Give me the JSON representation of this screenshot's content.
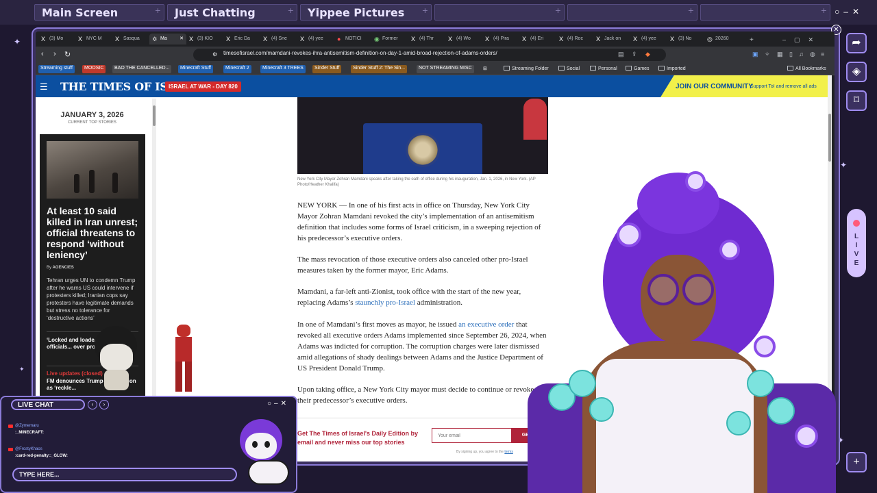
{
  "scenes": [
    {
      "label": "Main Screen"
    },
    {
      "label": "Just Chatting"
    },
    {
      "label": "Yippee Pictures"
    },
    {
      "label": ""
    },
    {
      "label": ""
    },
    {
      "label": ""
    }
  ],
  "browser": {
    "tabs": [
      {
        "icon": "X",
        "label": "(3) Mo"
      },
      {
        "icon": "X",
        "label": "NYC M"
      },
      {
        "icon": "X",
        "label": "Sasqua"
      },
      {
        "icon": "✡",
        "label": "Ma"
      },
      {
        "icon": "X",
        "label": "(3) KIO"
      },
      {
        "icon": "X",
        "label": "Eric Da"
      },
      {
        "icon": "X",
        "label": "(4) Sne"
      },
      {
        "icon": "X",
        "label": "(4) yee"
      },
      {
        "icon": "●",
        "label": "NOTICI"
      },
      {
        "icon": "◉",
        "label": "Former"
      },
      {
        "icon": "X",
        "label": "(4) Thr"
      },
      {
        "icon": "X",
        "label": "(4) Wo"
      },
      {
        "icon": "X",
        "label": "(4) Pira"
      },
      {
        "icon": "X",
        "label": "(4) Eri"
      },
      {
        "icon": "X",
        "label": "(4) Roc"
      },
      {
        "icon": "X",
        "label": "Jack on"
      },
      {
        "icon": "X",
        "label": "(4) yee"
      },
      {
        "icon": "X",
        "label": "(3) No"
      },
      {
        "icon": "◎",
        "label": "20260"
      }
    ],
    "url": "timesofisrael.com/mamdani-revokes-ihra-antisemitism-definition-on-day-1-amid-broad-rejection-of-adams-orders/",
    "bookmarks": [
      {
        "label": "Streaming stuff",
        "bg": "#1f5fae",
        "fg": "#ffffff"
      },
      {
        "label": "MOOSIC",
        "bg": "#c0392b",
        "fg": "#ffffff"
      },
      {
        "label": "BAO THE CANCELLED...",
        "bg": "#4a4b4f",
        "fg": "#ffffff"
      },
      {
        "label": "Minecraft Stuff",
        "bg": "#1f5fae",
        "fg": "#ffffff"
      },
      {
        "label": "Minecraft 2",
        "bg": "#1f5fae",
        "fg": "#ffffff"
      },
      {
        "label": "Minecraft 3 TREES",
        "bg": "#1f5fae",
        "fg": "#ffffff"
      },
      {
        "label": "Sinder Stuff",
        "bg": "#8a5a1e",
        "fg": "#ffffff"
      },
      {
        "label": "Sinder Stuff 2: The Sin...",
        "bg": "#8a5a1e",
        "fg": "#ffffff"
      },
      {
        "label": "NOT STREAMING MISC",
        "bg": "#4a4b4f",
        "fg": "#ffffff"
      }
    ],
    "folders": [
      "Streaming Folder",
      "Social",
      "Personal",
      "Games",
      "Imported"
    ],
    "all_bookmarks": "All Bookmarks"
  },
  "site": {
    "logo": "THE TIMES OF ISRAEL",
    "badge": "ISRAEL AT WAR - DAY 820",
    "join": "JOIN OUR COMMUNITY",
    "join_sub": "Support ToI and remove all ads"
  },
  "sidebar": {
    "date": "JANUARY 3, 2026",
    "date_sub": "CURRENT TOP STORIES",
    "headline": "At least 10 said killed in Iran unrest; official threatens to respond ‘without leniency’",
    "byline_prefix": "By",
    "byline": "AGENCIES",
    "sub_story": "Tehran urges UN to condemn Trump after he warns US could intervene if protesters killed; Iranian cops say protesters have legitimate demands but stress no tolerance for ‘destructive actions’",
    "sub2": "‘Locked and loade... Iranian officials... over protests",
    "live_label": "Live updates (closed)",
    "sub3": "FM denounces Trump intervention as ‘reckle..."
  },
  "article": {
    "caption": "New York City Mayor Zohran Mamdani speaks after taking the oath of office during his inauguration, Jan. 1, 2026, in New York. (AP Photo/Heather Khalifa)",
    "p1": "NEW YORK — In one of his first acts in office on Thursday, New York City Mayor Zohran Mamdani revoked the city’s implementation of an antisemitism definition that includes some forms of Israel criticism, in a sweeping rejection of his predecessor’s executive orders.",
    "p2": "The mass revocation of those executive orders also canceled other pro-Israel measures taken by the former mayor, Eric Adams.",
    "p3a": "Mamdani, a far-left anti-Zionist, took office with the start of the new year, replacing Adams’s ",
    "p3link": "staunchly pro-Israel",
    "p3b": " administration.",
    "p4a": "In one of Mamdani’s first moves as mayor, he issued ",
    "p4link": "an executive order",
    "p4b": " that revoked all executive orders Adams implemented since September 26, 2024, when Adams was indicted for corruption. The corruption charges were later dismissed amid allegations of shady dealings between Adams and the Justice Department of US President Donald Trump.",
    "p5": "Upon taking office, a New York City mayor must decide to continue or revoke their predecessor’s executive orders.",
    "signup_title": "Get The Times of Israel's Daily Edition by email and never miss our top stories",
    "email_placeholder": "Your email",
    "get_button": "GET IT",
    "agree_text": "By signing up, you agree to the",
    "agree_link": "terms"
  },
  "overlay": {
    "live_letters": "L\nI\nV\nE",
    "chat_title": "LIVE CHAT",
    "messages": [
      {
        "user": "@Zymemaru",
        "text": ":_MINECRAFT:"
      },
      {
        "user": "@FrostyKhaos",
        "text": ":card-red-penalty::_GLOW:"
      }
    ],
    "type_here": "TYPE HERE..."
  },
  "colors": {
    "accent": "#8b7bd8",
    "toi_blue": "#0b4fa0",
    "toi_red": "#d42a2a",
    "join_yellow": "#f2f04a",
    "signup_red": "#b0243a"
  }
}
